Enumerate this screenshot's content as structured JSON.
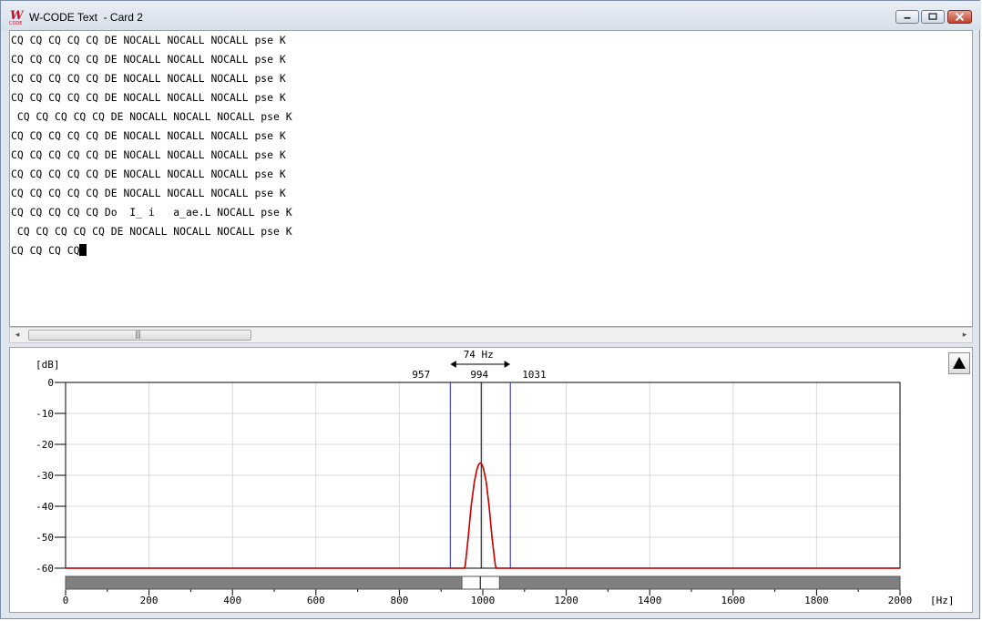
{
  "window": {
    "title": "W-CODE Text  - Card 2",
    "icon": "w-code-logo-icon",
    "controls": [
      "minimize-icon",
      "maximize-icon",
      "close-icon"
    ]
  },
  "decoded_text": {
    "lines": [
      "CQ CQ CQ CQ CQ DE NOCALL NOCALL NOCALL pse K",
      "CQ CQ CQ CQ CQ DE NOCALL NOCALL NOCALL pse K",
      "CQ CQ CQ CQ CQ DE NOCALL NOCALL NOCALL pse K",
      "CQ CQ CQ CQ CQ DE NOCALL NOCALL NOCALL pse K",
      " CQ CQ CQ CQ CQ DE NOCALL NOCALL NOCALL pse K",
      "CQ CQ CQ CQ CQ DE NOCALL NOCALL NOCALL pse K",
      "CQ CQ CQ CQ CQ DE NOCALL NOCALL NOCALL pse K",
      "CQ CQ CQ CQ CQ DE NOCALL NOCALL NOCALL pse K",
      "CQ CQ CQ CQ CQ DE NOCALL NOCALL NOCALL pse K",
      "CQ CQ CQ CQ CQ Do  I_ i   a_ae.L NOCALL pse K",
      " CQ CQ CQ CQ CQ DE NOCALL NOCALL NOCALL pse K",
      "CQ CQ CQ CQ"
    ]
  },
  "scrollbar": {
    "left_arrow": "◂",
    "right_arrow": "▸",
    "grip": "|||"
  },
  "spectrum": {
    "y_unit": "[dB]",
    "x_unit": "[Hz]",
    "bandwidth_label": "74 Hz",
    "low_edge_label": "957",
    "center_label": "994",
    "high_edge_label": "1031",
    "up_button_icon": "triangle-up-icon",
    "colors": {
      "passband_lines": "#2020c0",
      "center_line": "#000000",
      "trace": "#d00000",
      "waterfall_bar": "#808080",
      "grid": "#d8d8d8"
    }
  },
  "chart_data": {
    "type": "line",
    "xlabel": "[Hz]",
    "ylabel": "[dB]",
    "xlim": [
      0,
      2000
    ],
    "ylim": [
      -60,
      0
    ],
    "x_ticks": [
      0,
      200,
      400,
      600,
      800,
      1000,
      1200,
      1400,
      1600,
      1800,
      2000
    ],
    "y_ticks": [
      0,
      -10,
      -20,
      -30,
      -40,
      -50,
      -60
    ],
    "grid": true,
    "passband": {
      "low": 957,
      "center": 994,
      "high": 1031,
      "width": 74
    },
    "waterfall_window": [
      950,
      1040
    ],
    "series": [
      {
        "x": [
          0,
          956,
          958,
          965,
          972,
          980,
          986,
          990,
          994,
          998,
          1002,
          1008,
          1015,
          1022,
          1030,
          1032,
          2000
        ],
        "y": [
          -60,
          -60,
          -59,
          -50,
          -40,
          -32,
          -28,
          -26.5,
          -26,
          -26.5,
          -28,
          -32,
          -40,
          -50,
          -59,
          -60,
          -60
        ]
      }
    ]
  }
}
